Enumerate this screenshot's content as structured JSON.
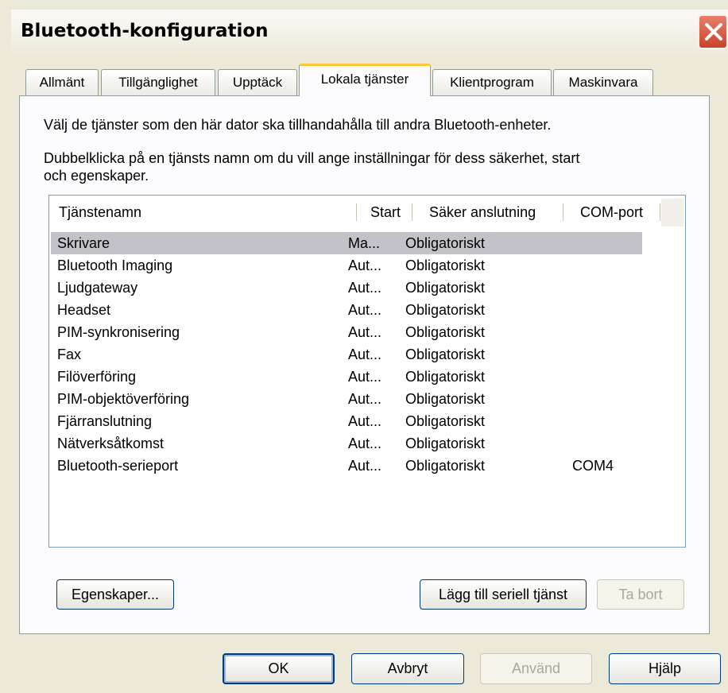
{
  "window": {
    "title": "Bluetooth-konfiguration"
  },
  "tabs": [
    {
      "label": "Allmänt"
    },
    {
      "label": "Tillgänglighet"
    },
    {
      "label": "Upptäck"
    },
    {
      "label": "Lokala tjänster"
    },
    {
      "label": "Klientprogram"
    },
    {
      "label": "Maskinvara"
    }
  ],
  "active_tab": "Lokala tjänster",
  "panel": {
    "description1": "Välj de tjänster som den här dator ska tillhandahålla till andra Bluetooth-enheter.",
    "description2_line1": "Dubbelklicka på en tjänsts namn om du vill ange inställningar för dess säkerhet, start",
    "description2_line2": "och egenskaper."
  },
  "list": {
    "columns": [
      "Tjänstenamn",
      "Start",
      "Säker anslutning",
      "COM-port"
    ],
    "rows": [
      {
        "name": "Skrivare",
        "start": "Ma...",
        "secure": "Obligatoriskt",
        "com": ""
      },
      {
        "name": "Bluetooth Imaging",
        "start": "Aut...",
        "secure": "Obligatoriskt",
        "com": ""
      },
      {
        "name": "Ljudgateway",
        "start": "Aut...",
        "secure": "Obligatoriskt",
        "com": ""
      },
      {
        "name": "Headset",
        "start": "Aut...",
        "secure": "Obligatoriskt",
        "com": ""
      },
      {
        "name": "PIM-synkronisering",
        "start": "Aut...",
        "secure": "Obligatoriskt",
        "com": ""
      },
      {
        "name": "Fax",
        "start": "Aut...",
        "secure": "Obligatoriskt",
        "com": ""
      },
      {
        "name": "Filöverföring",
        "start": "Aut...",
        "secure": "Obligatoriskt",
        "com": ""
      },
      {
        "name": "PIM-objektöverföring",
        "start": "Aut...",
        "secure": "Obligatoriskt",
        "com": ""
      },
      {
        "name": "Fjärranslutning",
        "start": "Aut...",
        "secure": "Obligatoriskt",
        "com": ""
      },
      {
        "name": "Nätverksåtkomst",
        "start": "Aut...",
        "secure": "Obligatoriskt",
        "com": ""
      },
      {
        "name": "Bluetooth-serieport",
        "start": "Aut...",
        "secure": "Obligatoriskt",
        "com": "COM4"
      }
    ],
    "selected_row": "Skrivare"
  },
  "panel_buttons": {
    "properties": "Egenskaper...",
    "add_serial": "Lägg till seriell tjänst",
    "remove": "Ta bort"
  },
  "dialog_buttons": {
    "ok": "OK",
    "cancel": "Avbryt",
    "apply": "Använd",
    "help": "Hjälp"
  },
  "colors": {
    "active_tab_accent": "#ffc83c",
    "selection": "#c3c2c8",
    "close_button": "#c8442a"
  }
}
